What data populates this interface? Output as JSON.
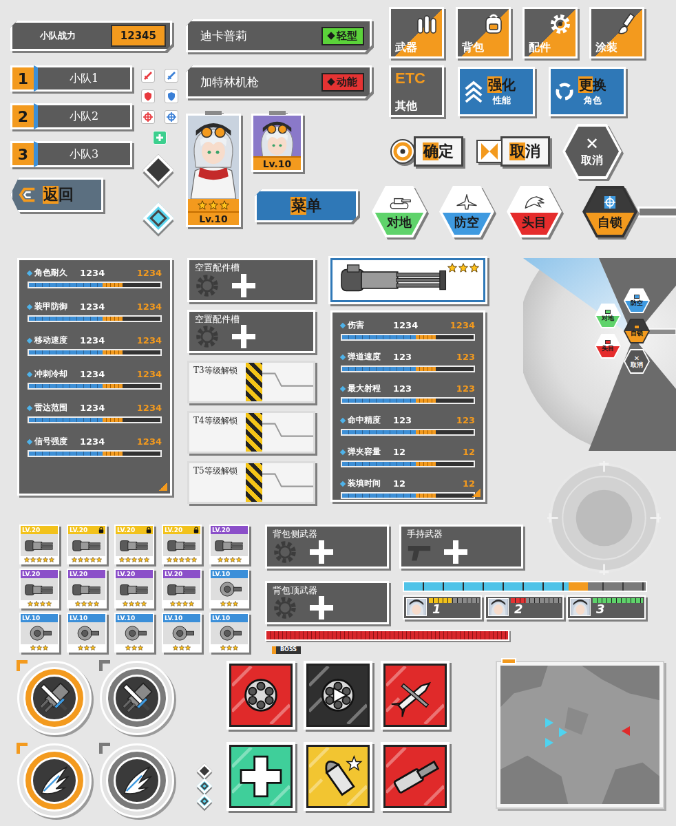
{
  "team_power": {
    "label": "小队战力",
    "value": "12345"
  },
  "squads": [
    {
      "number": "1",
      "label": "小队1"
    },
    {
      "number": "2",
      "label": "小队2"
    },
    {
      "number": "3",
      "label": "小队3"
    }
  ],
  "status_icons": [
    {
      "color": "#e8383d"
    },
    {
      "color": "#3a7fd6"
    },
    {
      "color": "#e8383d"
    },
    {
      "color": "#3a7fd6"
    },
    {
      "color": "#e8383d"
    },
    {
      "color": "#3a7fd6"
    },
    {
      "color": "#3ccf8e"
    }
  ],
  "back_button": {
    "label": "返回"
  },
  "diamonds": [
    {
      "selected": false
    },
    {
      "selected": true
    }
  ],
  "plates": [
    {
      "name": "迪卡普莉",
      "tag": "轻型",
      "color": "#5bd23a"
    },
    {
      "name": "加特林机枪",
      "tag": "动能",
      "color": "#e53333"
    }
  ],
  "character_cards": [
    {
      "kind": "full",
      "level": "Lv.10",
      "stars": 3
    },
    {
      "kind": "bust",
      "level": "Lv.10",
      "stars": 0
    }
  ],
  "menu_button": {
    "label": "菜单"
  },
  "nav_buttons": [
    {
      "label": "武器"
    },
    {
      "label": "背包"
    },
    {
      "label": "配件"
    },
    {
      "label": "涂装"
    }
  ],
  "other_button": {
    "badge": "ETC",
    "label": "其他"
  },
  "action_buttons": [
    {
      "title": "强化",
      "subtitle": "性能"
    },
    {
      "title": "更换",
      "subtitle": "角色"
    }
  ],
  "dialog_buttons": [
    {
      "kind": "confirm",
      "label": "确定"
    },
    {
      "kind": "cancel",
      "label": "取消"
    }
  ],
  "cancel_hex": {
    "glyph": "✕",
    "label": "取消"
  },
  "target_buttons": [
    {
      "label": "对地",
      "color": "#5fd36b",
      "selected": false
    },
    {
      "label": "防空",
      "color": "#3f9ae0",
      "selected": false
    },
    {
      "label": "头目",
      "color": "#e52c2c",
      "selected": false
    },
    {
      "label": "自锁",
      "color": "#f39a1e",
      "selected": true
    }
  ],
  "character_stats": [
    {
      "label": "角色耐久",
      "value": "1234",
      "max": "1234",
      "level": 0.56,
      "bonus": 0.15
    },
    {
      "label": "装甲防御",
      "value": "1234",
      "max": "1234",
      "level": 0.56,
      "bonus": 0.15
    },
    {
      "label": "移动速度",
      "value": "1234",
      "max": "1234",
      "level": 0.56,
      "bonus": 0.15
    },
    {
      "label": "冲刺冷却",
      "value": "1234",
      "max": "1234",
      "level": 0.56,
      "bonus": 0.15
    },
    {
      "label": "雷达范围",
      "value": "1234",
      "max": "1234",
      "level": 0.56,
      "bonus": 0.15
    },
    {
      "label": "信号强度",
      "value": "1234",
      "max": "1234",
      "level": 0.56,
      "bonus": 0.15
    }
  ],
  "part_slots": [
    {
      "label": "空置配件槽",
      "kind": "empty"
    },
    {
      "label": "空置配件槽",
      "kind": "empty"
    },
    {
      "label": "T3等级解锁",
      "kind": "locked"
    },
    {
      "label": "T4等级解锁",
      "kind": "locked"
    },
    {
      "label": "T5等级解锁",
      "kind": "locked"
    }
  ],
  "weapon": {
    "stars": 3,
    "stats": [
      {
        "label": "伤害",
        "value": "1234",
        "max": "1234",
        "level": 0.56,
        "bonus": 0.15
      },
      {
        "label": "弹道速度",
        "value": "123",
        "max": "123",
        "level": 0.56,
        "bonus": 0.15
      },
      {
        "label": "最大射程",
        "value": "123",
        "max": "123",
        "level": 0.56,
        "bonus": 0.15
      },
      {
        "label": "命中精度",
        "value": "123",
        "max": "123",
        "level": 0.56,
        "bonus": 0.15
      },
      {
        "label": "弹夹容量",
        "value": "12",
        "max": "12",
        "level": 0.56,
        "bonus": 0.15
      },
      {
        "label": "装填时间",
        "value": "12",
        "max": "12",
        "level": 0.56,
        "bonus": 0.15
      }
    ]
  },
  "radial_menu": [
    {
      "label": "对地",
      "kind": "target",
      "color": "#5fd36b",
      "selected": false,
      "glyph": ""
    },
    {
      "label": "防空",
      "kind": "target",
      "color": "#3f9ae0",
      "selected": false,
      "glyph": ""
    },
    {
      "label": "自锁",
      "kind": "target",
      "color": "#f39a1e",
      "selected": true,
      "glyph": ""
    },
    {
      "label": "头目",
      "kind": "target",
      "color": "#e52c2c",
      "selected": false,
      "glyph": ""
    },
    {
      "label": "取消",
      "kind": "cancel",
      "color": "#555555",
      "selected": false,
      "glyph": "✕"
    }
  ],
  "inventory": [
    {
      "level": "LV.20",
      "stars": 5,
      "color": "#f2c21b",
      "locked": false
    },
    {
      "level": "LV.20",
      "stars": 5,
      "color": "#f2c21b",
      "locked": true
    },
    {
      "level": "LV.20",
      "stars": 5,
      "color": "#f2c21b",
      "locked": true
    },
    {
      "level": "LV.20",
      "stars": 5,
      "color": "#f2c21b",
      "locked": true
    },
    {
      "level": "LV.20",
      "stars": 4,
      "color": "#8b4fc9",
      "locked": false
    },
    {
      "level": "LV.20",
      "stars": 4,
      "color": "#8b4fc9",
      "locked": false
    },
    {
      "level": "LV.20",
      "stars": 4,
      "color": "#8b4fc9",
      "locked": false
    },
    {
      "level": "LV.20",
      "stars": 4,
      "color": "#8b4fc9",
      "locked": false
    },
    {
      "level": "LV.20",
      "stars": 4,
      "color": "#8b4fc9",
      "locked": false
    },
    {
      "level": "LV.10",
      "stars": 3,
      "color": "#3b8fd9",
      "locked": false
    },
    {
      "level": "LV.10",
      "stars": 3,
      "color": "#3b8fd9",
      "locked": false
    },
    {
      "level": "LV.10",
      "stars": 3,
      "color": "#3b8fd9",
      "locked": false
    },
    {
      "level": "LV.10",
      "stars": 3,
      "color": "#3b8fd9",
      "locked": false
    },
    {
      "level": "LV.10",
      "stars": 3,
      "color": "#3b8fd9",
      "locked": false
    },
    {
      "level": "LV.10",
      "stars": 3,
      "color": "#3b8fd9",
      "locked": false
    }
  ],
  "weapon_slots": [
    {
      "label": "背包侧武器",
      "kind": "pack"
    },
    {
      "label": "手持武器",
      "kind": "hand"
    },
    {
      "label": "背包顶武器",
      "kind": "pack"
    }
  ],
  "team_hp": {
    "level": 0.68,
    "bonus": 0.08
  },
  "member_hp": [
    {
      "number": "1",
      "level": 0.45,
      "color": "#f2c21b"
    },
    {
      "number": "2",
      "level": 0.3,
      "color": "#e53333"
    },
    {
      "number": "3",
      "level": 1.0,
      "color": "#5fd36b"
    }
  ],
  "boss_hp": {
    "label": "BOSS",
    "level": 1.0
  },
  "skill_buttons": [
    {
      "kind": "weapon",
      "active": true
    },
    {
      "kind": "weapon",
      "active": false
    },
    {
      "kind": "dash",
      "active": true
    },
    {
      "kind": "dash",
      "active": false
    }
  ],
  "diamond_stack": [
    {
      "selected": false
    },
    {
      "selected": true
    },
    {
      "selected": true
    }
  ],
  "skill_icons": [
    {
      "kind": "gatling",
      "color": "#e02a2a"
    },
    {
      "kind": "gatling-play",
      "color": "#2f2f2f"
    },
    {
      "kind": "missile",
      "color": "#e02a2a"
    },
    {
      "kind": "heal",
      "color": "#3fcf9a"
    },
    {
      "kind": "ammo",
      "color": "#f2c531"
    },
    {
      "kind": "cannon",
      "color": "#e02a2a"
    }
  ],
  "minimap": {
    "markers": [
      {
        "side": "ally"
      },
      {
        "side": "ally"
      },
      {
        "side": "ally"
      },
      {
        "side": "enemy"
      }
    ]
  }
}
